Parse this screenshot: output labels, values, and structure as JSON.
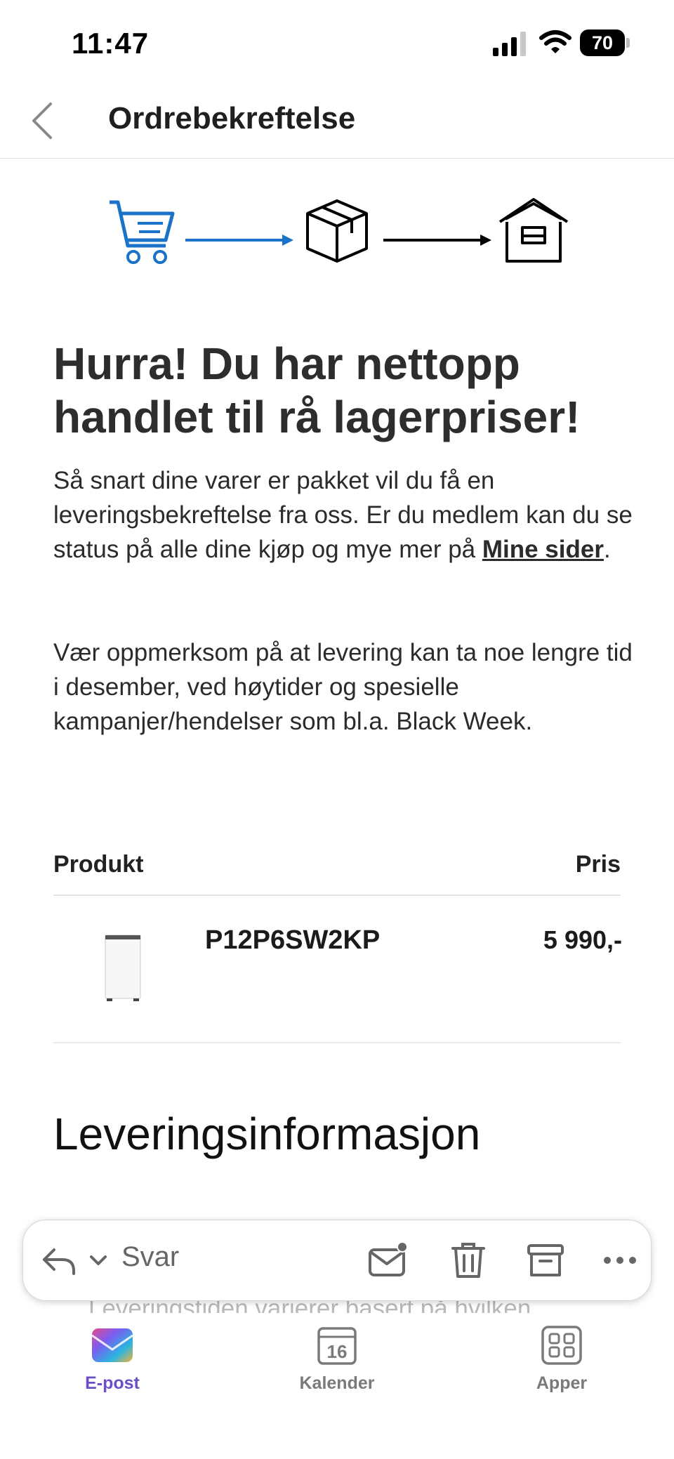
{
  "status_bar": {
    "time": "11:47",
    "battery": "70"
  },
  "nav": {
    "title": "Ordrebekreftelse"
  },
  "email": {
    "headline": "Hurra! Du har nettopp handlet til rå lagerpriser!",
    "body1_before": "Så snart dine varer er pakket vil du få en leveringsbekreftelse fra oss. Er du medlem kan du se status på alle dine kjøp og mye mer på ",
    "body1_link": "Mine sider",
    "body1_after": ".",
    "body2": "Vær oppmerksom på at levering kan ta noe lengre tid i desember, ved høytider og spesielle kampanjer/hendelser som bl.a. Black Week.",
    "table": {
      "col_product": "Produkt",
      "col_price": "Pris"
    },
    "product": {
      "name": "P12P6SW2KP",
      "price": "5 990,-"
    },
    "section_title": "Leveringsinformasjon",
    "faded_text": "Leveringstiden varierer basert på hvilken"
  },
  "reply_bar": {
    "label": "Svar"
  },
  "tab_bar": {
    "mail": "E-post",
    "calendar": "Kalender",
    "calendar_day": "16",
    "apps": "Apper"
  },
  "colors": {
    "accent_blue": "#1a73c8",
    "tab_active": "#6a4fc8"
  }
}
